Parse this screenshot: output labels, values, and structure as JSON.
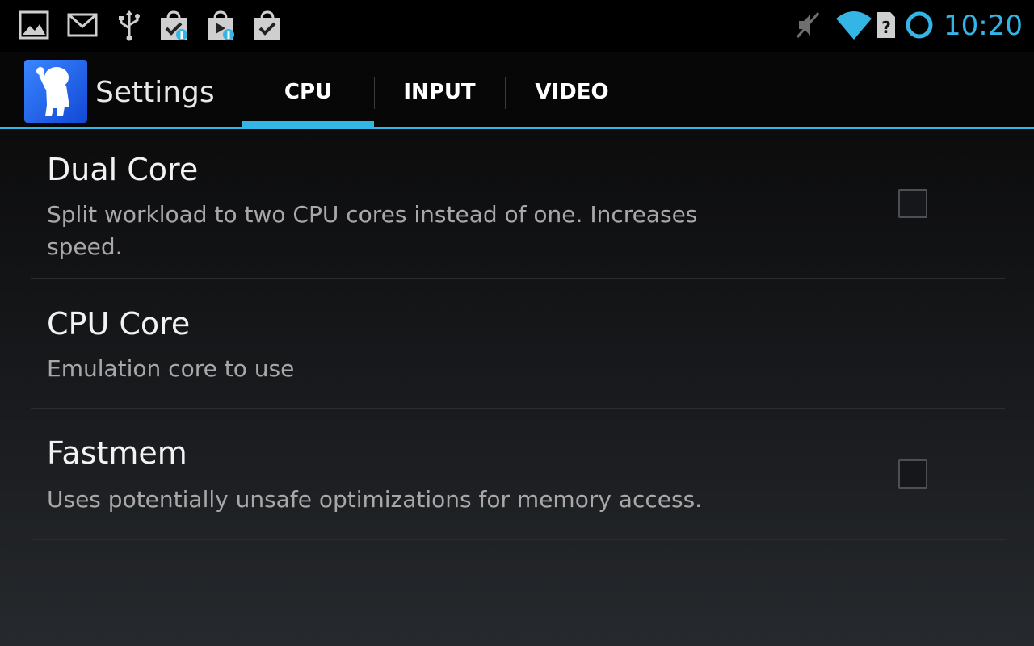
{
  "status_bar": {
    "icons": [
      "gallery-icon",
      "gmail-icon",
      "usb-icon",
      "market-update-icon",
      "play-store-update-icon",
      "market-installed-icon"
    ],
    "right_icons": [
      "mute-icon",
      "wifi-icon",
      "no-sim-icon",
      "sync-icon"
    ],
    "time": "10:20"
  },
  "action_bar": {
    "app_icon": "app-logo-icon",
    "title": "Settings",
    "tabs": [
      {
        "label": "CPU",
        "selected": true
      },
      {
        "label": "INPUT",
        "selected": false
      },
      {
        "label": "VIDEO",
        "selected": false
      }
    ]
  },
  "preferences": [
    {
      "title": "Dual Core",
      "summary": "Split workload to two CPU cores instead of one. Increases speed.",
      "has_checkbox": true,
      "checked": false
    },
    {
      "title": "CPU Core",
      "summary": "Emulation core to use",
      "has_checkbox": false
    },
    {
      "title": "Fastmem",
      "summary": "Uses potentially unsafe optimizations for memory access.",
      "has_checkbox": true,
      "checked": false
    }
  ],
  "colors": {
    "accent": "#33b5e5",
    "title_text": "#f2f2f2",
    "summary_text": "#a8a8a8"
  }
}
